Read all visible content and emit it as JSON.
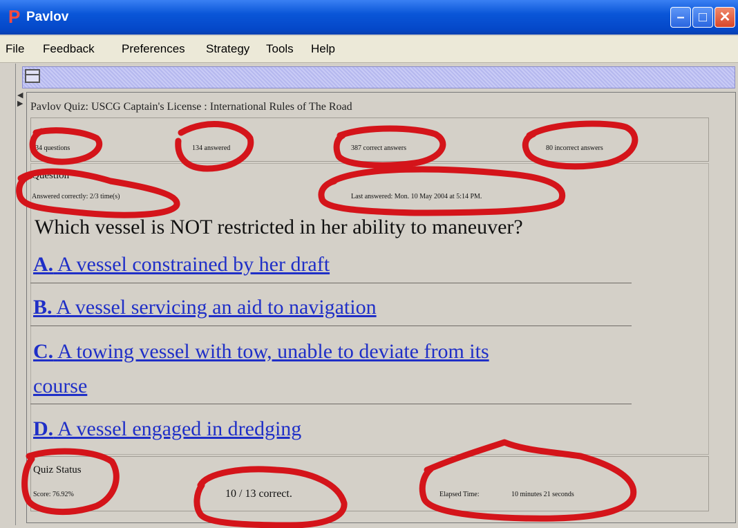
{
  "window": {
    "title": "Pavlov",
    "app_icon_letter": "P",
    "controls": {
      "minimize_glyph": "–",
      "maximize_glyph": "□",
      "close_glyph": "✕"
    }
  },
  "menu": [
    "File",
    "Feedback",
    "Preferences",
    "Strategy",
    "Tools",
    "Help"
  ],
  "quiz_title": "Pavlov Quiz: USCG Captain's License : International Rules of The Road",
  "progress": {
    "questions": "134 questions",
    "answered": "134 answered",
    "correct_answers": "387 correct answers",
    "incorrect_answers": "80 incorrect answers"
  },
  "question": {
    "section_label": "Question",
    "answered_correctly": "Answered correctly: 2/3 time(s)",
    "last_answered": "Last answered: Mon. 10 May 2004 at 5:14 PM.",
    "text": "Which vessel is NOT restricted in her ability to maneuver?",
    "answers": [
      {
        "letter": "A.",
        "text": "A vessel constrained by her draft"
      },
      {
        "letter": "B.",
        "text": "A vessel servicing an aid to navigation"
      },
      {
        "letter": "C.",
        "text": "A towing vessel with tow, unable to deviate from its",
        "text_line2": "course"
      },
      {
        "letter": "D.",
        "text": "A vessel engaged in dredging"
      }
    ]
  },
  "status": {
    "section_label": "Quiz Status",
    "score": "Score: 76.92%",
    "correct_count": "10 / 13 correct.",
    "elapsed_label": "Elapsed Time:",
    "elapsed_value": "10 minutes 21 seconds"
  },
  "colors": {
    "titlebar": "#0a56d8",
    "link": "#1f2fc7",
    "annotation": "#d4141a"
  }
}
